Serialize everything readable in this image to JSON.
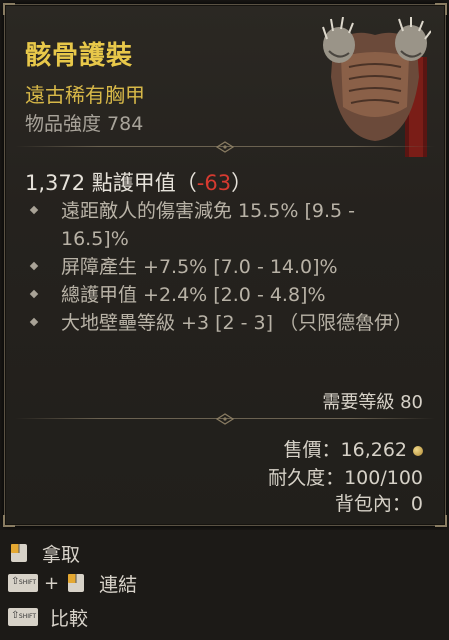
{
  "item": {
    "name": "骸骨護裝",
    "type": "遠古稀有胸甲",
    "power_label": "物品強度 784"
  },
  "armor": {
    "value": "1,372 點護甲值",
    "open": "（",
    "delta": "-63",
    "close": "）"
  },
  "affixes": [
    {
      "text": "遠距敵人的傷害減免 15.5% [9.5 - 16.5]%"
    },
    {
      "text": "屏障產生 +7.5% [7.0 - 14.0]%"
    },
    {
      "text": "總護甲值 +2.4% [2.0 - 4.8]%"
    },
    {
      "text": "大地壁壘等級 +3 [2 - 3] （只限德魯伊）"
    }
  ],
  "requirements": {
    "level": "需要等級 80"
  },
  "sell": {
    "label": "售價：16,262"
  },
  "durability": {
    "label": "耐久度：100/100"
  },
  "bag": {
    "label": "背包內：0"
  },
  "actions": {
    "pickup": "拿取",
    "link": "連結",
    "compare": "比較",
    "shift_key": "SHIFT",
    "plus": "+"
  },
  "colors": {
    "legendary_name": "#e8c84a",
    "negative": "#d63a30",
    "text": "#d6d1c7"
  }
}
